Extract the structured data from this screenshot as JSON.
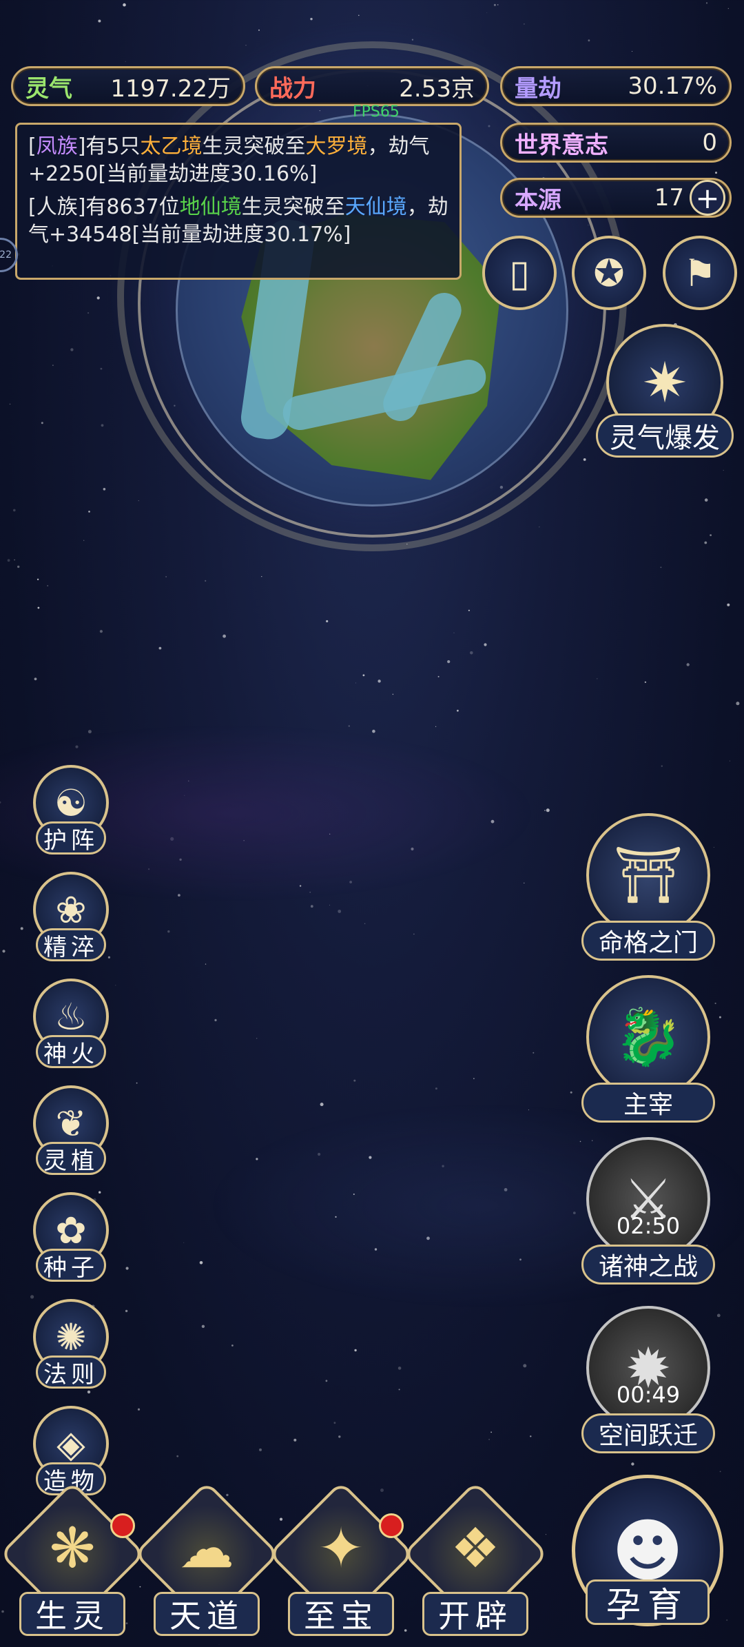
{
  "stats": {
    "lingqi": {
      "label": "灵气",
      "value": "1197.22万"
    },
    "zhanli": {
      "label": "战力",
      "value": "2.53京"
    },
    "liangjie": {
      "label": "量劫",
      "value": "30.17%"
    },
    "shijie": {
      "label": "世界意志",
      "value": "0"
    },
    "benyuan": {
      "label": "本源",
      "value": "17"
    }
  },
  "fps": "FPS65",
  "log": [
    {
      "prefix": "[",
      "race": "凤族",
      "mid1": "]有5只",
      "realm_from": "太乙境",
      "mid2": "生灵突破至",
      "realm_to": "大罗境",
      "suffix": "，劫气+2250[当前量劫进度30.16%]"
    },
    {
      "prefix": "[",
      "race": "人族",
      "mid1": "]有8637位",
      "realm_from": "地仙境",
      "mid2": "生灵突破至",
      "realm_to": "天仙境",
      "suffix": "，劫气+34548[当前量劫进度30.17%]"
    }
  ],
  "edge_badge": "22",
  "top_icons": [
    "card-icon",
    "vortex-icon",
    "banner-icon"
  ],
  "lingqi_baofa": {
    "label": "灵气爆发",
    "icon": "burst-icon"
  },
  "left_menu": [
    {
      "label": "护阵",
      "icon": "yin-yang-icon",
      "glyph": "☯"
    },
    {
      "label": "精淬",
      "icon": "lotus-flame-icon",
      "glyph": "❀"
    },
    {
      "label": "神火",
      "icon": "fire-icon",
      "glyph": "♨"
    },
    {
      "label": "灵植",
      "icon": "plant-icon",
      "glyph": "❦"
    },
    {
      "label": "种子",
      "icon": "seed-flower-icon",
      "glyph": "✿"
    },
    {
      "label": "法则",
      "icon": "rule-beast-icon",
      "glyph": "✺"
    },
    {
      "label": "造物",
      "icon": "creation-diamond-icon",
      "glyph": "◈"
    }
  ],
  "right_menu": [
    {
      "label": "命格之门",
      "icon": "gate-icon",
      "glyph": "⛩",
      "timer": ""
    },
    {
      "label": "主宰",
      "icon": "dragon-icon",
      "glyph": "🐉",
      "timer": ""
    },
    {
      "label": "诸神之战",
      "icon": "sword-icon",
      "glyph": "⚔",
      "timer": "02:50"
    },
    {
      "label": "空间跃迁",
      "icon": "portal-icon",
      "glyph": "✹",
      "timer": "00:49"
    }
  ],
  "bottom_nav": [
    {
      "label": "生灵",
      "icon": "creature-icon",
      "glyph": "❋",
      "badge": true
    },
    {
      "label": "天道",
      "icon": "heaven-icon",
      "glyph": "☁",
      "badge": false
    },
    {
      "label": "至宝",
      "icon": "treasure-icon",
      "glyph": "✦",
      "badge": true
    },
    {
      "label": "开辟",
      "icon": "creation-flame-icon",
      "glyph": "❖",
      "badge": false
    }
  ],
  "yunyu": {
    "label": "孕育",
    "icon": "fetus-icon",
    "glyph": "☻"
  },
  "colors": {
    "gold": "#c9a86a",
    "accent_red": "#d81f1f"
  }
}
